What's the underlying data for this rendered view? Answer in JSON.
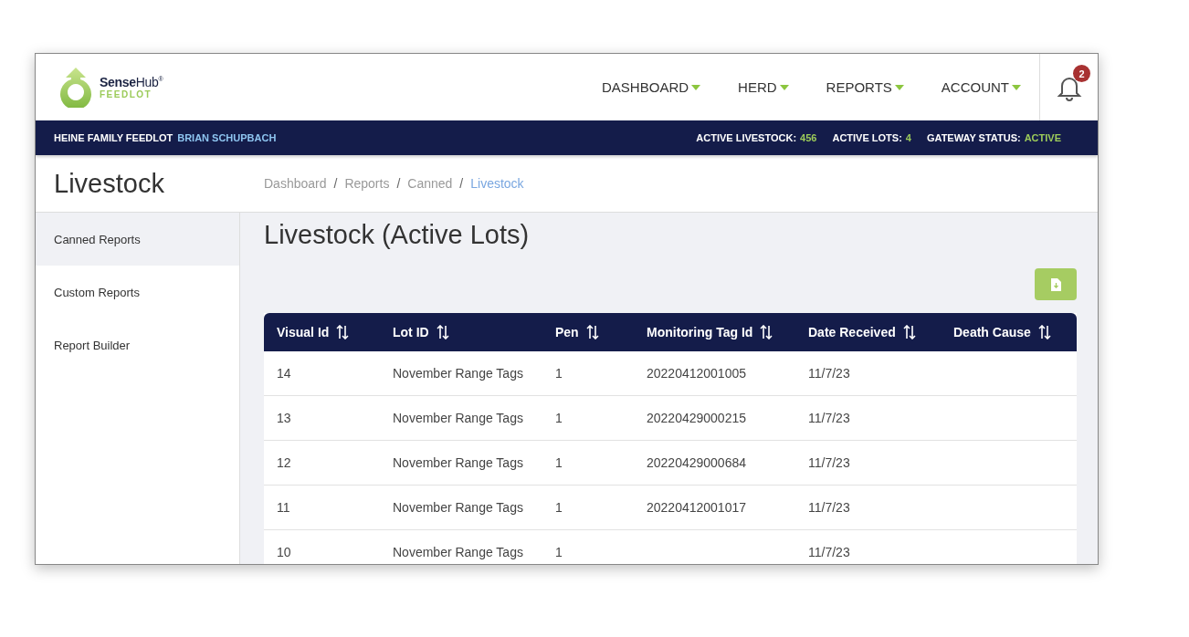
{
  "brand": {
    "name_bold": "Sense",
    "name_rest": "Hub",
    "mark": "®",
    "subtitle": "FEEDLOT"
  },
  "nav": [
    {
      "label": "DASHBOARD"
    },
    {
      "label": "HERD"
    },
    {
      "label": "REPORTS"
    },
    {
      "label": "ACCOUNT"
    }
  ],
  "notifications": {
    "count": "2"
  },
  "info_bar": {
    "farm": "HEINE FAMILY FEEDLOT",
    "user": "BRIAN SCHUPBACH",
    "stats": [
      {
        "label": "ACTIVE LIVESTOCK:",
        "value": "456"
      },
      {
        "label": "ACTIVE LOTS:",
        "value": "4"
      },
      {
        "label": "GATEWAY STATUS:",
        "value": "ACTIVE"
      }
    ]
  },
  "page_title": "Livestock",
  "breadcrumb_separator": "/",
  "breadcrumbs": [
    {
      "label": "Dashboard",
      "selected": false
    },
    {
      "label": "Reports",
      "selected": false
    },
    {
      "label": "Canned",
      "selected": false
    },
    {
      "label": "Livestock",
      "selected": true
    }
  ],
  "sidebar": {
    "items": [
      {
        "label": "Canned Reports",
        "selected": true
      },
      {
        "label": "Custom Reports",
        "selected": false
      },
      {
        "label": "Report Builder",
        "selected": false
      }
    ]
  },
  "report_title": "Livestock (Active Lots)",
  "table": {
    "columns": [
      "Visual Id",
      "Lot ID",
      "Pen",
      "Monitoring Tag Id",
      "Date Received",
      "Death Cause"
    ],
    "rows": [
      [
        "14",
        "November Range Tags",
        "1",
        "20220412001005",
        "11/7/23",
        ""
      ],
      [
        "13",
        "November Range Tags",
        "1",
        "20220429000215",
        "11/7/23",
        ""
      ],
      [
        "12",
        "November Range Tags",
        "1",
        "20220429000684",
        "11/7/23",
        ""
      ],
      [
        "11",
        "November Range Tags",
        "1",
        "20220412001017",
        "11/7/23",
        ""
      ],
      [
        "10",
        "November Range Tags",
        "1",
        "",
        "11/7/23",
        ""
      ]
    ]
  }
}
